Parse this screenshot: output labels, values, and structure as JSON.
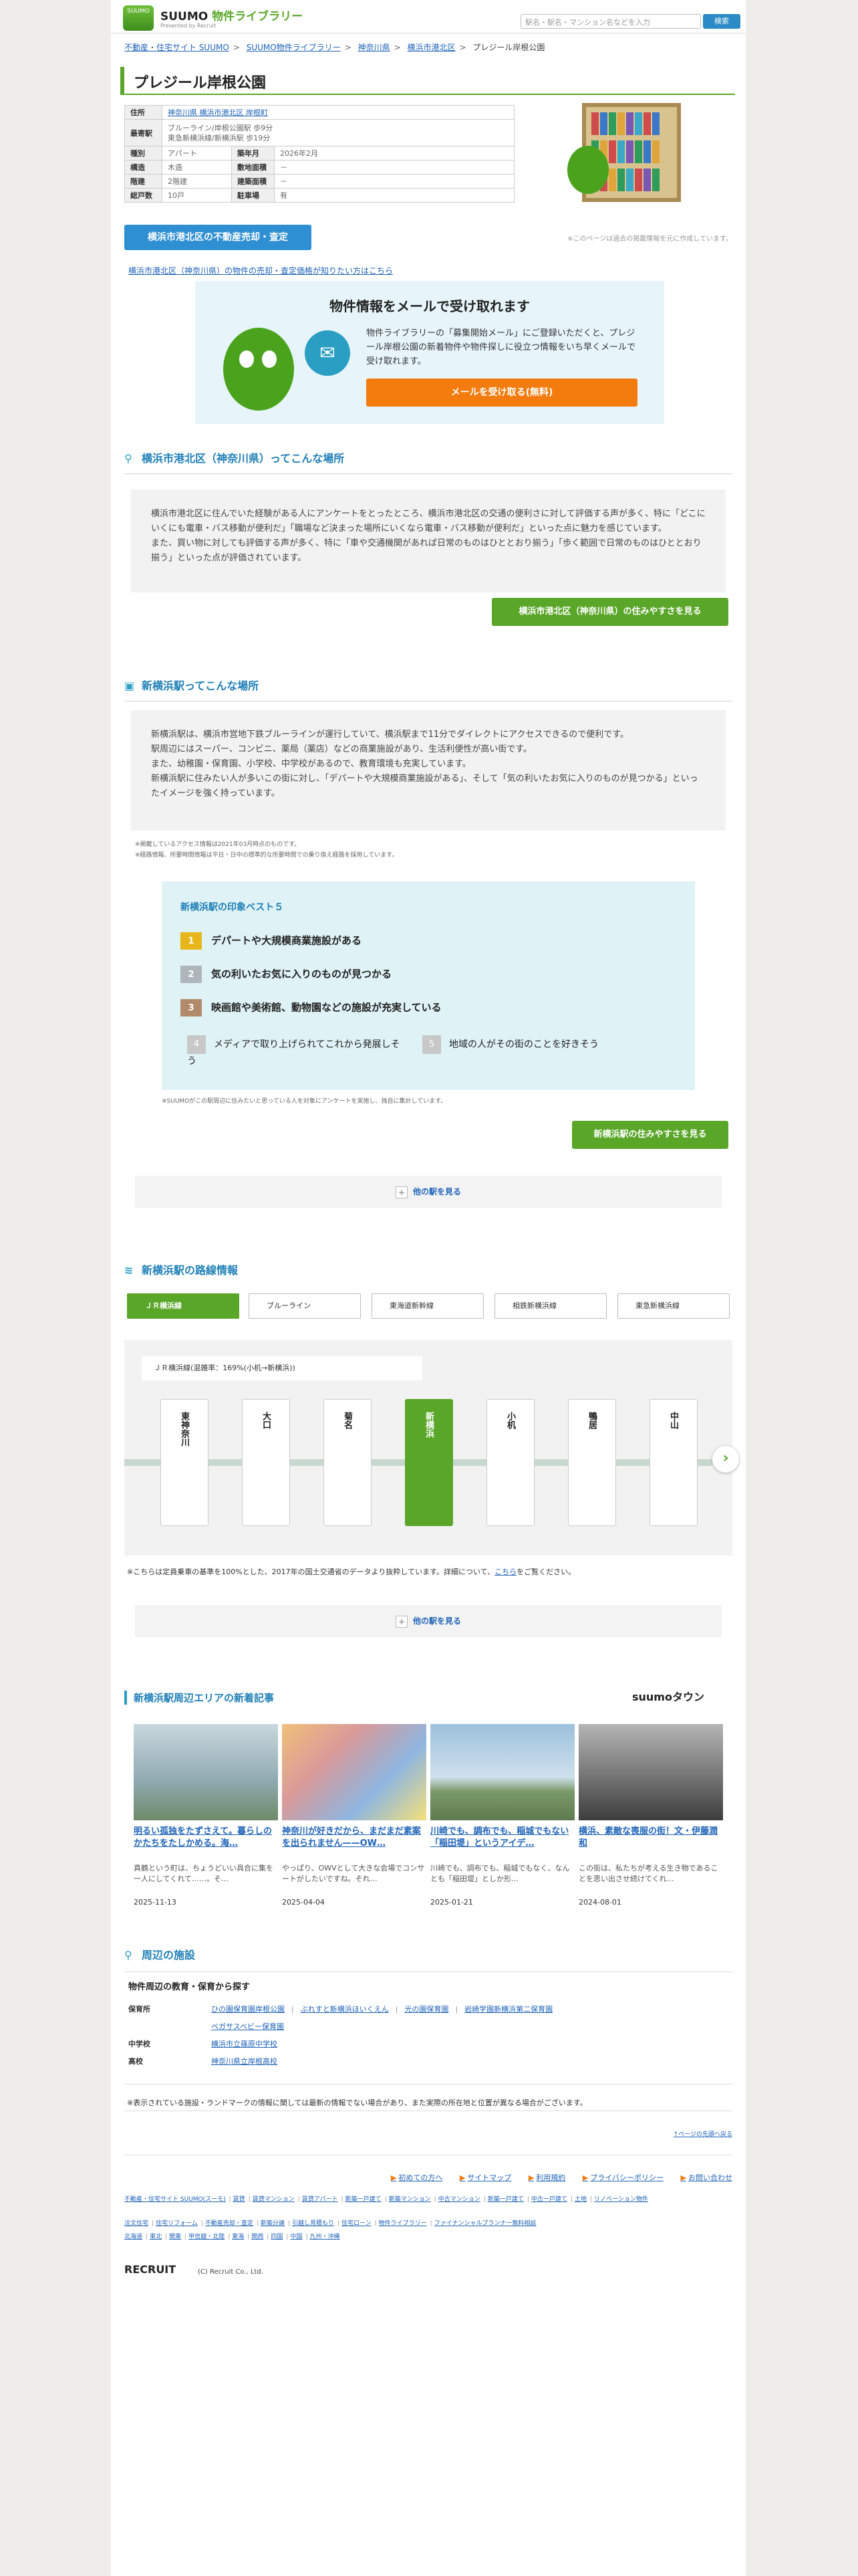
{
  "header": {
    "logo_badge": "SUUMO",
    "logo_main": "SUUMO",
    "logo_suffix": "物件ライブラリー",
    "logo_sub": "Presented by Recruit",
    "search_placeholder": "駅名・駅名・マンション名などを入力",
    "search_button": "検索"
  },
  "breadcrumb": [
    "不動産・住宅サイト SUUMO",
    "SUUMO物件ライブラリー",
    "神奈川県",
    "横浜市港北区",
    "プレジール岸根公園"
  ],
  "title": "プレジール岸根公園",
  "info": {
    "rows": [
      {
        "k": "住所",
        "v": "神奈川県 横浜市港北区 岸根町",
        "wide": true,
        "link": true
      },
      {
        "k": "最寄駅",
        "v": "ブルーライン/岸根公園駅 歩9分\n東急新横浜線/新横浜駅 歩19分",
        "wide": true
      },
      {
        "k": "種別",
        "v": "アパート",
        "k2": "築年月",
        "v2": "2026年2月"
      },
      {
        "k": "構造",
        "v": "木造",
        "k2": "敷地面積",
        "v2": "－"
      },
      {
        "k": "階建",
        "v": "2階建",
        "k2": "建築面積",
        "v2": "－"
      },
      {
        "k": "総戸数",
        "v": "10戸",
        "k2": "駐車場",
        "v2": "有"
      }
    ],
    "sell_button": "横浜市港北区の不動産売却・査定",
    "image_note": "※このページは過去の掲載情報を元に作成しています。",
    "sell_link": "横浜市港北区（神奈川県）の物件の売却・査定価格が知りたい方はこちら"
  },
  "mail": {
    "heading": "物件情報をメールで受け取れます",
    "text": "物件ライブラリーの「募集開始メール」にご登録いただくと、プレジール岸根公園の新着物件や物件探しに役立つ情報をいち早くメールで受け取れます。",
    "button": "メールを受け取る(無料)",
    "envelope_icon": "✉"
  },
  "area": {
    "heading": "横浜市港北区（神奈川県）ってこんな場所",
    "body": "横浜市港北区に住んでいた経験がある人にアンケートをとったところ、横浜市港北区の交通の便利さに対して評価する声が多く、特に「どこにいくにも電車・バス移動が便利だ」「職場など決まった場所にいくなら電車・バス移動が便利だ」といった点に魅力を感じています。\nまた、買い物に対しても評価する声が多く、特に「車や交通機関があれば日常のものはひととおり揃う」「歩く範囲で日常のものはひととおり揃う」といった点が評価されています。",
    "button": "横浜市港北区（神奈川県）の住みやすさを見る"
  },
  "station": {
    "heading": "新横浜駅ってこんな場所",
    "body": "新横浜駅は、横浜市営地下鉄ブルーラインが運行していて、横浜駅まで11分でダイレクトにアクセスできるので便利です。\n駅周辺にはスーパー、コンビニ、薬局（薬店）などの商業施設があり、生活利便性が高い街です。\nまた、幼稚園・保育園、小学校、中学校があるので、教育環境も充実しています。\n新横浜駅に住みたい人が多いこの街に対し、「デパートや大規模商業施設がある」、そして「気の利いたお気に入りのものが見つかる」といったイメージを強く持っています。",
    "note1": "※掲載しているアクセス情報は2021年03月時点のものです。",
    "note2": "※経路情報、所要時間情報は平日・日中の標準的な所要時間での乗り換え経路を採用しています。",
    "best_title": "新横浜駅の印象ベスト５",
    "best": [
      "デパートや大規模商業施設がある",
      "気の利いたお気に入りのものが見つかる",
      "映画館や美術館、動物園などの施設が充実している",
      "メディアで取り上げられてこれから発展しそう",
      "地域の人がその街のことを好きそう"
    ],
    "best_numbers": [
      "1",
      "2",
      "3",
      "4",
      "5"
    ],
    "survey_note": "※SUUMOがこの駅周辺に住みたいと思っている人を対象にアンケートを実施し、独自に集計しています。",
    "button": "新横浜駅の住みやすさを見る",
    "more": "他の駅を見る"
  },
  "lines": {
    "heading": "新横浜駅の路線情報",
    "tabs": [
      "ＪＲ横浜線",
      "ブルーライン",
      "東海道新幹線",
      "相鉄新横浜線",
      "東急新横浜線"
    ],
    "congestion": "ＪＲ横浜線(混雑率：169%(小机→新横浜))",
    "stations": [
      "東神奈川",
      "大口",
      "菊名",
      "新横浜",
      "小机",
      "鴨居",
      "中山"
    ],
    "note_prefix": "※こちらは定員乗車の基準を100%とした、2017年の国土交通省のデータより抜粋しています。詳細について、",
    "note_link": "こちら",
    "note_suffix": "をご覧ください。",
    "more": "他の駅を見る"
  },
  "articles": {
    "heading": "新横浜駅周辺エリアの新着記事",
    "brand": "suumoタウン",
    "items": [
      {
        "title": "明るい孤独をたずさえて。暮らしのかたちをたしかめる。海…",
        "desc": "真鶴という町は、ちょうどいい具合に集を一人にしてくれて……。そ…",
        "date": "2025-11-13",
        "color": "#8fa9b0"
      },
      {
        "title": "神奈川が好きだから、まだまだ素案を出られません——OW…",
        "desc": "やっぱり、OWVとして大きな会場でコンサートがしたいですね。それ…",
        "date": "2025-04-04",
        "color": "#d99a9a"
      },
      {
        "title": "川崎でも、調布でも、稲城でもない「稲田堤」というアイデ…",
        "desc": "川崎でも、調布でも、稲城でもなく、なんとも「稲田堤」としか形…",
        "date": "2025-01-21",
        "color": "#9cc1dc"
      },
      {
        "title": "横浜、素敵な喪服の街！文・伊藤潤和",
        "desc": "この街は、私たちが考える生き物であることを思い出させ続けてくれ…",
        "date": "2024-08-01",
        "color": "#7a7a7a"
      }
    ]
  },
  "facilities": {
    "heading": "周辺の施設",
    "sub": "物件周辺の教育・保育から探す",
    "rows": [
      {
        "k": "保育所",
        "v": [
          "ひの園保育園岸根公園",
          "ぶれすと新横浜ほいくえん",
          "光の園保育園",
          "岩崎学園新横浜第二保育園"
        ]
      },
      {
        "k": "",
        "v": [
          "ベガサスベビー保育園"
        ]
      },
      {
        "k": "中学校",
        "v": [
          "横浜市立篠原中学校"
        ]
      },
      {
        "k": "高校",
        "v": [
          "神奈川県立岸根高校"
        ]
      }
    ],
    "note": "※表示されている施設・ランドマークの情報に関しては最新の情報でない場合があり、また実際の所在地と位置が異なる場合がございます。",
    "top_link": "↑ページの先頭へ戻る"
  },
  "footer": {
    "links": [
      "初めての方へ",
      "サイトマップ",
      "利用規約",
      "プライバシーポリシー",
      "お問い合わせ"
    ],
    "row1": [
      "不動産・住宅サイト SUUMO(スーモ)",
      "賃貸",
      "賃貸マンション",
      "賃貸アパート",
      "新築一戸建て",
      "新築マンション",
      "中古マンション",
      "新築一戸建て",
      "中古一戸建て",
      "土地",
      "リノベーション物件"
    ],
    "row2": [
      "注文住宅",
      "住宅リフォーム",
      "不動産売却・査定",
      "新築分譲",
      "引越し見積もり",
      "住宅ローン",
      "物件ライブラリー",
      "ファイナンシャルプランナー無料相談"
    ],
    "row3": [
      "北海道",
      "東北",
      "関東",
      "甲信越・北陸",
      "東海",
      "関西",
      "四国",
      "中国",
      "九州・沖縄"
    ],
    "recruit": "RECRUIT",
    "copyright": "(C) Recruit Co., Ltd."
  }
}
